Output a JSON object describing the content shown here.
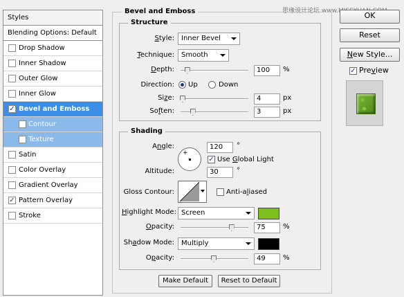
{
  "styles_panel": {
    "header": "Styles",
    "blending": "Blending Options: Default",
    "items": [
      {
        "label": "Drop Shadow",
        "checked": false
      },
      {
        "label": "Inner Shadow",
        "checked": false
      },
      {
        "label": "Outer Glow",
        "checked": false
      },
      {
        "label": "Inner Glow",
        "checked": false
      },
      {
        "label": "Bevel and Emboss",
        "checked": true
      },
      {
        "label": "Contour",
        "checked": false
      },
      {
        "label": "Texture",
        "checked": false
      },
      {
        "label": "Satin",
        "checked": false
      },
      {
        "label": "Color Overlay",
        "checked": false
      },
      {
        "label": "Gradient Overlay",
        "checked": false
      },
      {
        "label": "Pattern Overlay",
        "checked": true
      },
      {
        "label": "Stroke",
        "checked": false
      }
    ],
    "check_glyph": "✓"
  },
  "bevel": {
    "title": "Bevel and Emboss",
    "structure_title": "Structure",
    "style_label_pre": "",
    "style_label_u": "S",
    "style_label_post": "tyle:",
    "style_value": "Inner Bevel",
    "technique_label_pre": "",
    "technique_label_u": "T",
    "technique_label_post": "echnique:",
    "technique_value": "Smooth",
    "depth_label_pre": "",
    "depth_label_u": "D",
    "depth_label_post": "epth:",
    "depth_value": "100",
    "depth_unit": "%",
    "depth_level": 0.1,
    "direction_label": "Direction:",
    "direction_up": "Up",
    "direction_down": "Down",
    "size_label_pre": "Si",
    "size_label_u": "z",
    "size_label_post": "e:",
    "size_value": "4",
    "size_unit": "px",
    "size_level": 0.03,
    "soften_label_pre": "So",
    "soften_label_u": "f",
    "soften_label_post": "ten:",
    "soften_value": "3",
    "soften_unit": "px",
    "soften_level": 0.18
  },
  "shading": {
    "title": "Shading",
    "angle_label_pre": "A",
    "angle_label_u": "n",
    "angle_label_post": "gle:",
    "angle_value": "120",
    "angle_unit": "°",
    "global_light_pre": "Use ",
    "global_light_u": "G",
    "global_light_post": "lobal Light",
    "altitude_label": "Altitude:",
    "altitude_value": "30",
    "altitude_unit": "°",
    "gloss_label": "Gloss Contour:",
    "anti_aliased_pre": "Anti-a",
    "anti_aliased_u": "l",
    "anti_aliased_post": "iased",
    "highlight_mode_label_pre": "",
    "highlight_mode_label_u": "H",
    "highlight_mode_label_post": "ighlight Mode:",
    "highlight_mode_value": "Screen",
    "highlight_color": "#7dc01d",
    "highlight_opacity_label_pre": "",
    "highlight_opacity_label_u": "O",
    "highlight_opacity_label_post": "pacity:",
    "highlight_opacity_value": "75",
    "highlight_opacity_unit": "%",
    "highlight_opacity_level": 0.75,
    "shadow_mode_label_pre": "Sh",
    "shadow_mode_label_u": "a",
    "shadow_mode_label_post": "dow Mode:",
    "shadow_mode_value": "Multiply",
    "shadow_color": "#000000",
    "shadow_opacity_label_pre": "O",
    "shadow_opacity_label_u": "p",
    "shadow_opacity_label_post": "acity:",
    "shadow_opacity_value": "49",
    "shadow_opacity_unit": "%",
    "shadow_opacity_level": 0.49,
    "make_default": "Make Default",
    "reset_default": "Reset to Default"
  },
  "right": {
    "ok": "OK",
    "reset": "Reset",
    "new_style_pre": "",
    "new_style_u": "N",
    "new_style_post": "ew Style...",
    "preview_pre": "Pre",
    "preview_u": "v",
    "preview_post": "iew",
    "preview_checked": true
  },
  "watermark": "思缘设计论坛 www.MISSYUAN.COM"
}
